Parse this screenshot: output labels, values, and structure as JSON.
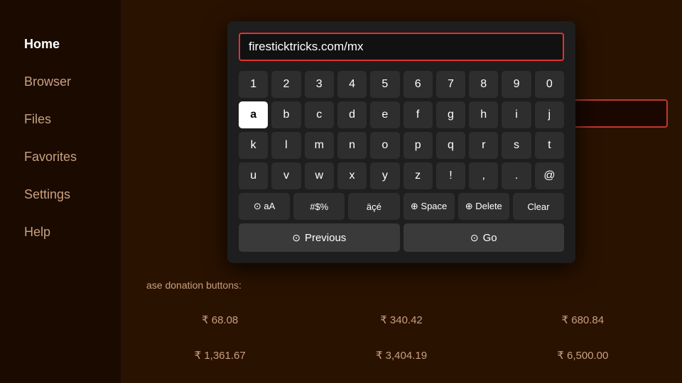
{
  "sidebar": {
    "items": [
      {
        "label": "Home",
        "active": true
      },
      {
        "label": "Browser",
        "active": false
      },
      {
        "label": "Files",
        "active": false
      },
      {
        "label": "Favorites",
        "active": false
      },
      {
        "label": "Settings",
        "active": false
      },
      {
        "label": "Help",
        "active": false
      }
    ]
  },
  "keyboard": {
    "url_value": "firesticktricks.com/mx",
    "rows": {
      "numbers": [
        "1",
        "2",
        "3",
        "4",
        "5",
        "6",
        "7",
        "8",
        "9",
        "0"
      ],
      "row1": [
        "a",
        "b",
        "c",
        "d",
        "e",
        "f",
        "g",
        "h",
        "i",
        "j"
      ],
      "row2": [
        "k",
        "l",
        "m",
        "n",
        "o",
        "p",
        "q",
        "r",
        "s",
        "t"
      ],
      "row3": [
        "u",
        "v",
        "w",
        "x",
        "y",
        "z",
        "!",
        ",",
        ".",
        "@"
      ],
      "special": [
        "⊙ aA",
        "#$%",
        "äçé",
        "⊕ Space",
        "⊕ Delete",
        "Clear"
      ]
    },
    "nav": {
      "previous_label": "Previous",
      "go_label": "Go"
    },
    "active_key": "a"
  },
  "bg": {
    "donation_text": "ase donation buttons:",
    "row1": [
      "₹ 68.08",
      "₹ 340.42",
      "₹ 680.84"
    ],
    "row2": [
      "₹ 1,361.67",
      "₹ 3,404.19",
      "₹ 6,500.00"
    ]
  }
}
